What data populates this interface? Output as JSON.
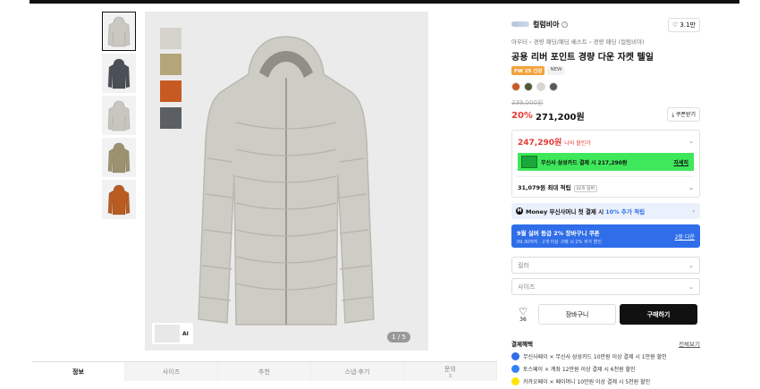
{
  "thumbnails": [
    {
      "name": "light-gray",
      "color": "#c9c8c1"
    },
    {
      "name": "charcoal",
      "color": "#4b4f56"
    },
    {
      "name": "light-gray-2",
      "color": "#c8c7bf"
    },
    {
      "name": "khaki",
      "color": "#9d926f"
    },
    {
      "name": "orange",
      "color": "#b85c22"
    }
  ],
  "main_image": {
    "swatches": [
      "#d5d3cc",
      "#b4a57b",
      "#c65a22",
      "#5b5f64"
    ],
    "jacket_color": "#cdccc5",
    "ai_label": "AI",
    "counter": "1 / 5"
  },
  "tabs": [
    {
      "label": "정보",
      "sub": ""
    },
    {
      "label": "사이즈",
      "sub": ""
    },
    {
      "label": "추천",
      "sub": ""
    },
    {
      "label": "스냅·후기",
      "sub": ""
    },
    {
      "label": "문의",
      "sub": "3"
    }
  ],
  "product": {
    "brand": "컬럼비아",
    "likes": "3.1만",
    "breadcrumb": "아우터 › 경량 패딩/패딩 베스트 › 경량 패딩 (컬럼비아)",
    "title": "공용 리버 포인트 경량 다운 자켓 텔일",
    "badge_season": "FW 25 신상",
    "badge_new": "NEW",
    "colors": [
      "#c65a22",
      "#4d5a35",
      "#d8d6cf",
      "#555a5e"
    ],
    "original_price": "339,000원",
    "discount": "20%",
    "price": "271,200원",
    "coupon_label": "쿠폰받기",
    "my_price": "247,290원",
    "my_price_label": "나의 할인가",
    "card_offer": "무신사 삼성카드 결제 시 217,290원",
    "card_link": "자세히",
    "points": "31,079원 최대 적립",
    "points_tag": "LV.6 실버",
    "money_text": "Money 무신사머니 첫 결제 시",
    "money_highlight": "10% 추가 적립",
    "promo_title": "9월 실버 등급 2% 장바구니 쿠폰",
    "promo_sub": "09.30까지 · 2개 이상 구매 시 2% 추가 할인",
    "promo_link": "2장 다운",
    "color_select": "컬러",
    "size_select": "사이즈",
    "like_count": "36",
    "cart_label": "장바구니",
    "buy_label": "구매하기",
    "benefits_title": "결제혜택",
    "benefits_all": "전체보기",
    "benefits": [
      {
        "text": "무신사페이 × 무신사 삼성카드 10만원 이상 결제 시 1만원 할인",
        "color": "#2f6ee8"
      },
      {
        "text": "토스페이 × 계좌 12만원 이상 결제 시 6천원 할인",
        "color": "#3182f6"
      },
      {
        "text": "카카오페이 × 페이머니 10만원 이상 결제 시 5천원 할인",
        "color": "#fee500"
      }
    ]
  }
}
